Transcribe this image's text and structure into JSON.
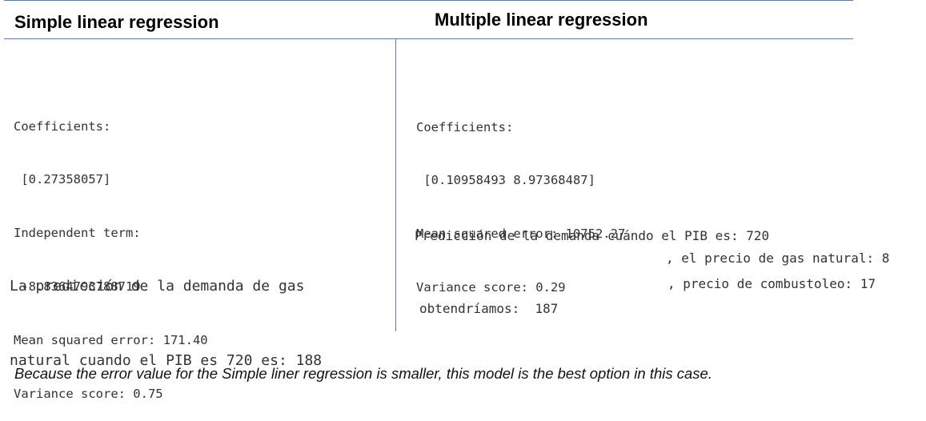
{
  "simple": {
    "title": "Simple linear regression",
    "coef_label": "Coefficients:",
    "coef_value": " [0.27358057]",
    "intercept_label": "Independent term:",
    "intercept_value": " -8.8364793788719",
    "mse": "Mean squared error: 171.40",
    "variance": "Variance score: 0.75",
    "prediction_line1": "La predicción de la demanda de gas",
    "prediction_line2": "natural cuando el PIB es 720 es: 188"
  },
  "multiple": {
    "title": "Multiple linear regression",
    "coef_label": "Coefficients:",
    "coef_value": " [0.10958493 8.97368487]",
    "mse": "Mean squared error: 10752.27",
    "variance": "Variance score: 0.29",
    "prediction_line1": "Predicción de la demanda cuándo el PIB es: 720",
    "prediction_line2": ", el precio de gas natural: 8",
    "prediction_line3": ", precio de combustoleo: 17",
    "result": "obtendríamos:  187"
  },
  "footer": {
    "conclusion": "Because the error value for the Simple liner regression is smaller, this model is the best option in this case."
  }
}
